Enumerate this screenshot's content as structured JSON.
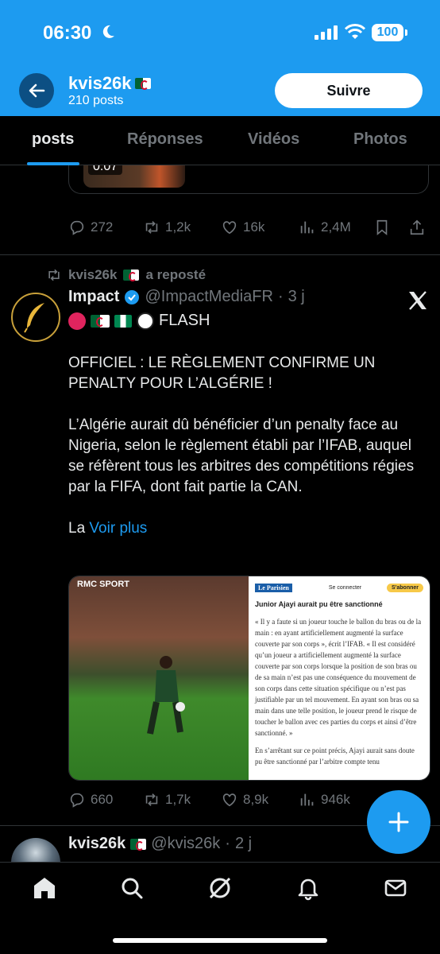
{
  "status_bar": {
    "time": "06:30",
    "battery": "100"
  },
  "header": {
    "name": "kvis26k",
    "posts_count": "210 posts",
    "follow_label": "Suivre"
  },
  "tabs": [
    {
      "label": "posts",
      "active": true
    },
    {
      "label": "Réponses",
      "active": false
    },
    {
      "label": "Vidéos",
      "active": false
    },
    {
      "label": "Photos",
      "active": false
    }
  ],
  "prev_tweet": {
    "duration": "0:07",
    "replies": "272",
    "reposts": "1,2k",
    "likes": "16k",
    "views": "2,4M"
  },
  "tweet": {
    "reposted_by": "kvis26k",
    "reposted_label": "a reposté",
    "author_name": "Impact",
    "author_handle": "@ImpactMediaFR",
    "age": "3 j",
    "flash": "FLASH",
    "headline": "OFFICIEL : LE RÈGLEMENT CONFIRME UN PENALTY POUR L’ALGÉRIE !",
    "body": "L’Algérie aurait dû bénéficier d’un penalty face au Nigeria, selon le règlement établi par l’IFAB, auquel se réfèrent tous les arbitres des compétitions régies par la FIFA, dont fait partie la CAN.",
    "tail": "La",
    "more_label": "Voir plus",
    "replies": "660",
    "reposts": "1,7k",
    "likes": "8,9k",
    "views": "946k",
    "media": {
      "photo_brand": "RMC SPORT",
      "article_logo": "Le Parisien",
      "article_connect": "Se connecter",
      "article_subscribe": "S'abonner",
      "article_title": "Junior Ajayi aurait pu être sanctionné",
      "article_p1": "« Il y a faute si un joueur touche le ballon du bras ou de la main : en ayant artificiellement augmenté la surface couverte par son corps », écrit l’IFAB. « Il est considéré qu’un joueur a artificiellement augmenté la surface couverte par son corps lorsque la position de son bras ou de sa main n’est pas une conséquence du mouvement de son corps dans cette situation spécifique ou n’est pas justifiable par un tel mouvement. En ayant son bras ou sa main dans une telle position, le joueur prend le risque de toucher le ballon avec ces parties du corps et ainsi d’être sanctionné. »",
      "article_p2": "En s’arrêtant sur ce point précis, Ajayi aurait sans doute pu être sanctionné par l’arbitre compte tenu"
    }
  },
  "next_tweet": {
    "author_name": "kvis26k",
    "author_handle": "@kvis26k",
    "age": "2 j"
  },
  "colors": {
    "accent": "#1d9bf0",
    "background": "#000000",
    "muted": "#71767b"
  }
}
